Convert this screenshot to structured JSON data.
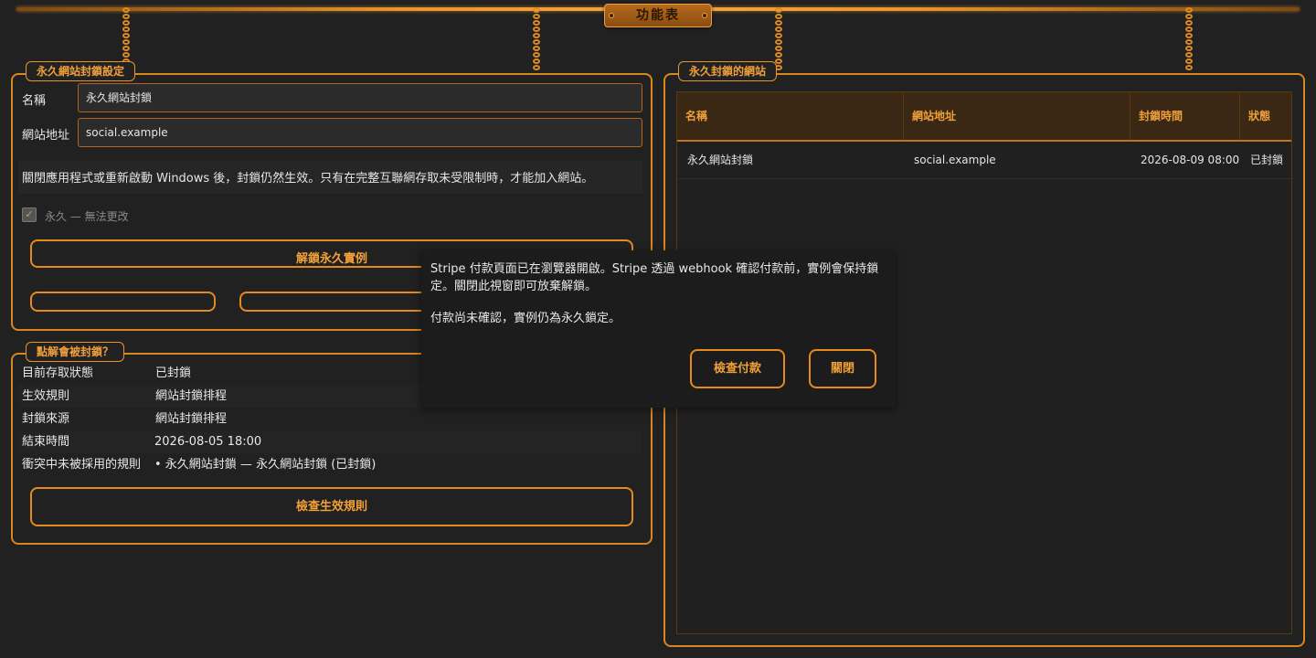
{
  "window": {
    "menu_plaque": "功能表"
  },
  "settings": {
    "legend": "永久網站封鎖設定",
    "name_label": "名稱",
    "name_value": "永久網站封鎖",
    "url_label": "網站地址",
    "url_value": "social.example",
    "note": "關閉應用程式或重新啟動 Windows 後，封鎖仍然生效。只有在完整互聯網存取未受限制時，才能加入網站。",
    "permanent_checkbox_label": "永久 — 無法更改",
    "permanent_checked": true,
    "unlock_button": "解鎖永久實例",
    "left_button": "",
    "right_button": ""
  },
  "why_blocked": {
    "legend": "點解會被封鎖？",
    "rows": [
      {
        "key": "目前存取狀態",
        "value": "已封鎖"
      },
      {
        "key": "生效規則",
        "value": "網站封鎖排程"
      },
      {
        "key": "封鎖來源",
        "value": "網站封鎖排程"
      },
      {
        "key": "結束時間",
        "value": "2026-08-05 18:00"
      },
      {
        "key": "衝突中未被採用的規則",
        "value": "• 永久網站封鎖 — 永久網站封鎖 (已封鎖)"
      }
    ],
    "check_button": "檢查生效規則"
  },
  "blocked_sites": {
    "legend": "永久封鎖的網站",
    "columns": [
      "名稱",
      "網站地址",
      "封鎖時間",
      "狀態"
    ],
    "rows": [
      {
        "name": "永久網站封鎖",
        "url": "social.example",
        "time": "2026-08-09 08:00",
        "status": "已封鎖"
      }
    ]
  },
  "dialog": {
    "message": "Stripe 付款頁面已在瀏覽器開啟。Stripe 透過 webhook 確認付款前，實例會保持鎖定。關閉此視窗即可放棄解鎖。",
    "status": "付款尚未確認，實例仍為永久鎖定。",
    "check_payment_button": "檢查付款",
    "close_button": "關閉"
  },
  "colors": {
    "accent": "#e58a1e",
    "background": "#212121",
    "header": "#3a2814"
  }
}
